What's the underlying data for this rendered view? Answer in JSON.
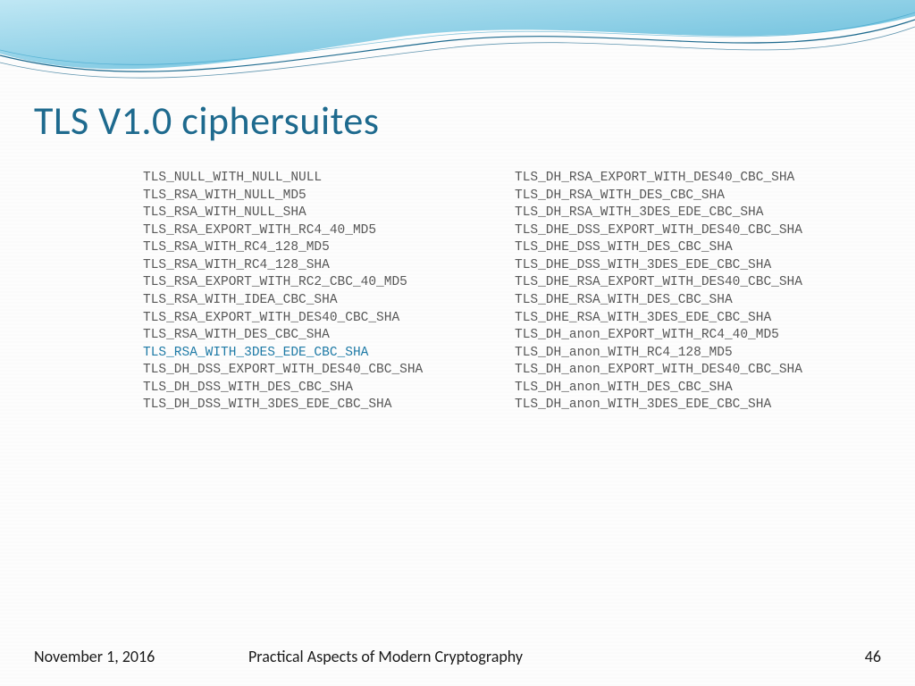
{
  "slide": {
    "title": "TLS V1.0 ciphersuites"
  },
  "columns": {
    "left": [
      {
        "text": "TLS_NULL_WITH_NULL_NULL",
        "hl": false
      },
      {
        "text": "TLS_RSA_WITH_NULL_MD5",
        "hl": false
      },
      {
        "text": "TLS_RSA_WITH_NULL_SHA",
        "hl": false
      },
      {
        "text": "TLS_RSA_EXPORT_WITH_RC4_40_MD5",
        "hl": false
      },
      {
        "text": "TLS_RSA_WITH_RC4_128_MD5",
        "hl": false
      },
      {
        "text": "TLS_RSA_WITH_RC4_128_SHA",
        "hl": false
      },
      {
        "text": "TLS_RSA_EXPORT_WITH_RC2_CBC_40_MD5",
        "hl": false
      },
      {
        "text": "TLS_RSA_WITH_IDEA_CBC_SHA",
        "hl": false
      },
      {
        "text": "TLS_RSA_EXPORT_WITH_DES40_CBC_SHA",
        "hl": false
      },
      {
        "text": "TLS_RSA_WITH_DES_CBC_SHA",
        "hl": false
      },
      {
        "text": "TLS_RSA_WITH_3DES_EDE_CBC_SHA",
        "hl": true
      },
      {
        "text": "TLS_DH_DSS_EXPORT_WITH_DES40_CBC_SHA",
        "hl": false
      },
      {
        "text": "TLS_DH_DSS_WITH_DES_CBC_SHA",
        "hl": false
      },
      {
        "text": "TLS_DH_DSS_WITH_3DES_EDE_CBC_SHA",
        "hl": false
      }
    ],
    "right": [
      {
        "text": "TLS_DH_RSA_EXPORT_WITH_DES40_CBC_SHA",
        "hl": false
      },
      {
        "text": "TLS_DH_RSA_WITH_DES_CBC_SHA",
        "hl": false
      },
      {
        "text": "TLS_DH_RSA_WITH_3DES_EDE_CBC_SHA",
        "hl": false
      },
      {
        "text": "TLS_DHE_DSS_EXPORT_WITH_DES40_CBC_SHA",
        "hl": false
      },
      {
        "text": "TLS_DHE_DSS_WITH_DES_CBC_SHA",
        "hl": false
      },
      {
        "text": "TLS_DHE_DSS_WITH_3DES_EDE_CBC_SHA",
        "hl": false
      },
      {
        "text": "TLS_DHE_RSA_EXPORT_WITH_DES40_CBC_SHA",
        "hl": false
      },
      {
        "text": "TLS_DHE_RSA_WITH_DES_CBC_SHA",
        "hl": false
      },
      {
        "text": "TLS_DHE_RSA_WITH_3DES_EDE_CBC_SHA",
        "hl": false
      },
      {
        "text": "TLS_DH_anon_EXPORT_WITH_RC4_40_MD5",
        "hl": false
      },
      {
        "text": "TLS_DH_anon_WITH_RC4_128_MD5",
        "hl": false
      },
      {
        "text": "TLS_DH_anon_EXPORT_WITH_DES40_CBC_SHA",
        "hl": false
      },
      {
        "text": "TLS_DH_anon_WITH_DES_CBC_SHA",
        "hl": false
      },
      {
        "text": "TLS_DH_anon_WITH_3DES_EDE_CBC_SHA",
        "hl": false
      }
    ]
  },
  "footer": {
    "date": "November 1, 2016",
    "course": "Practical Aspects of Modern Cryptography",
    "page": "46"
  },
  "theme": {
    "title_color": "#1e6a8e",
    "highlight_color": "#1e7aa6",
    "body_color": "#575757",
    "wave_light": "#b5e2f2",
    "wave_dark": "#2f9dc6",
    "wave_line": "#1e6a8e"
  }
}
